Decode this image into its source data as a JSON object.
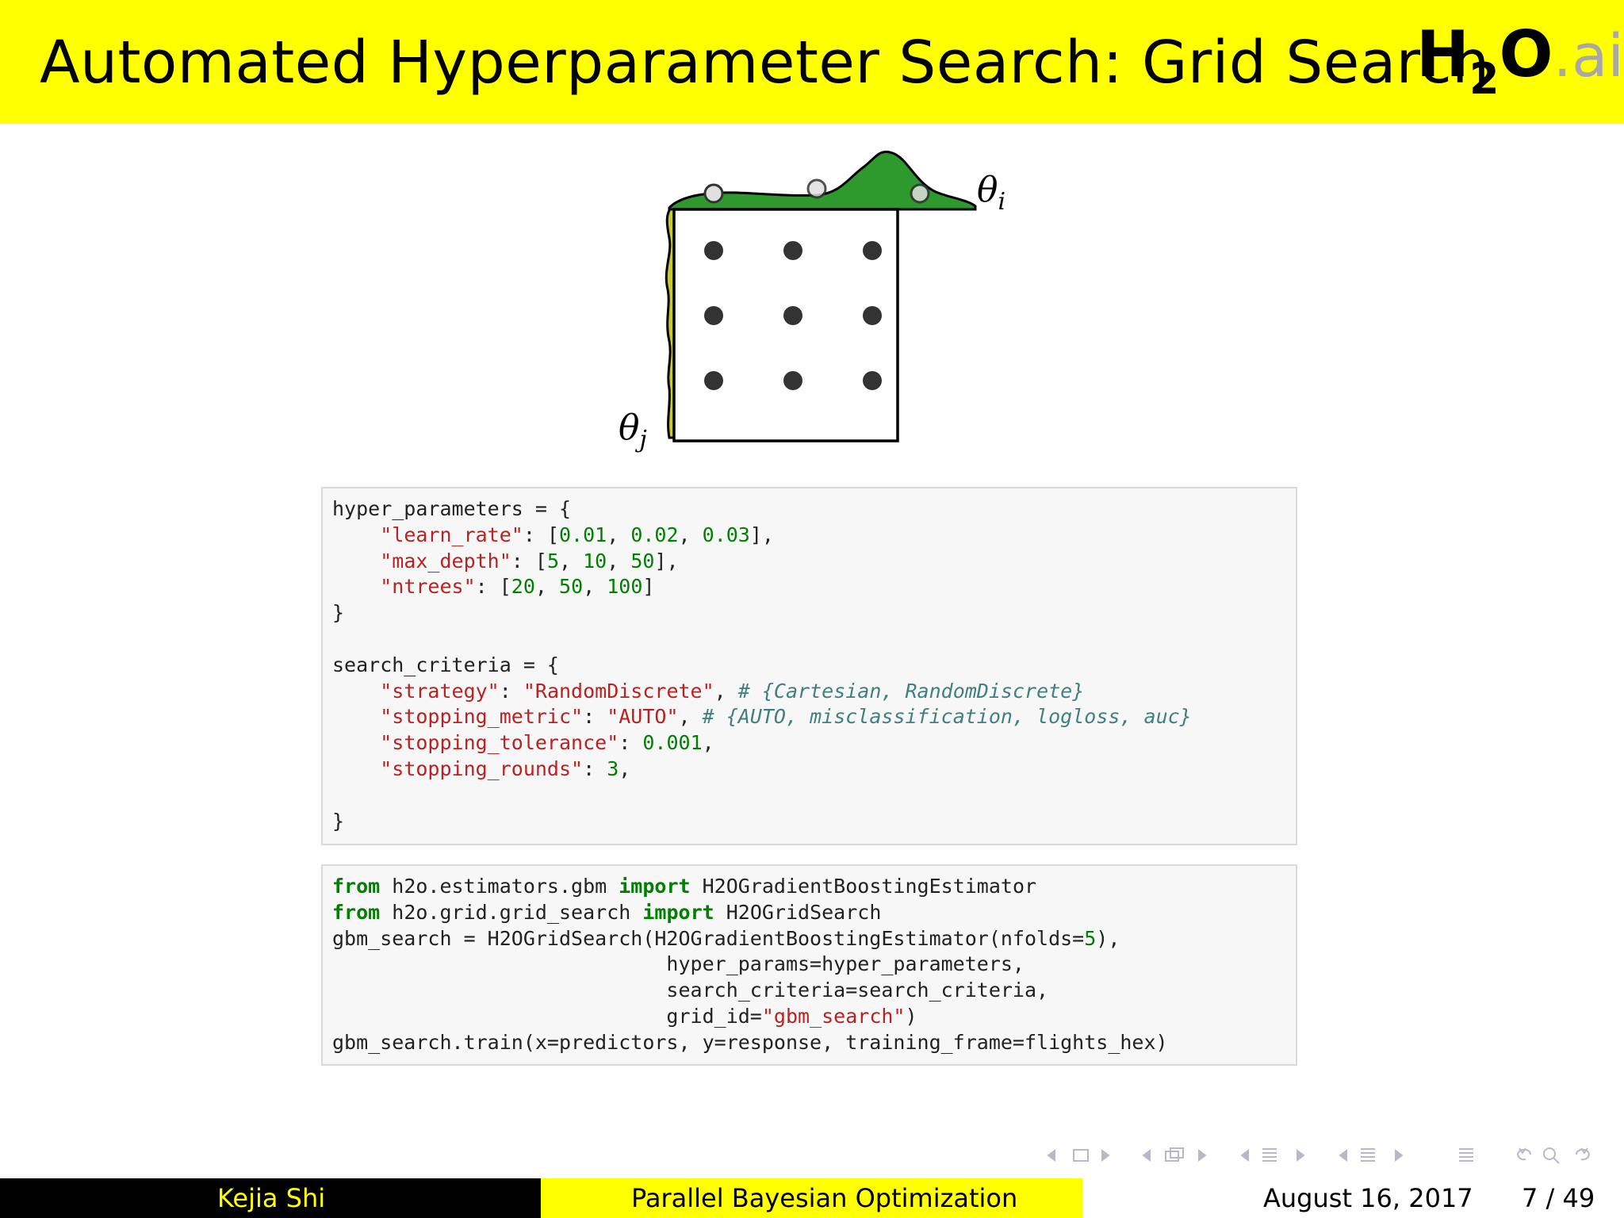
{
  "header": {
    "title": "Automated Hyperparameter Search: Grid Search",
    "logo": {
      "h": "H",
      "two": "2",
      "o": "O",
      "ai": ".ai"
    }
  },
  "diagram": {
    "label_i": "θ",
    "label_i_sub": "i",
    "label_j": "θ",
    "label_j_sub": "j",
    "grid_rows": 3,
    "grid_cols": 3,
    "colors": {
      "top_curve": "#2e9a2e",
      "left_curve": "#c8c830",
      "point": "#333333"
    }
  },
  "code1": {
    "l1": "hyper_parameters = {",
    "l2_key": "\"learn_rate\"",
    "l2_sep": ": [",
    "l2_v1": "0.01",
    "l2_v2": "0.02",
    "l2_v3": "0.03",
    "l2_end": "],",
    "l3_key": "\"max_depth\"",
    "l3_sep": ": [",
    "l3_v1": "5",
    "l3_v2": "10",
    "l3_v3": "50",
    "l3_end": "],",
    "l4_key": "\"ntrees\"",
    "l4_sep": ": [",
    "l4_v1": "20",
    "l4_v2": "50",
    "l4_v3": "100",
    "l4_end": "]",
    "l5": "}",
    "l7": "search_criteria = {",
    "l8_key": "\"strategy\"",
    "l8_sep": ": ",
    "l8_val": "\"RandomDiscrete\"",
    "l8_comma": ", ",
    "l8_comment": "# {Cartesian, RandomDiscrete}",
    "l9_key": "\"stopping_metric\"",
    "l9_sep": ": ",
    "l9_val": "\"AUTO\"",
    "l9_comma": ", ",
    "l9_comment": "# {AUTO, misclassification, logloss, auc}",
    "l10_key": "\"stopping_tolerance\"",
    "l10_sep": ": ",
    "l10_val": "0.001",
    "l10_end": ",",
    "l11_key": "\"stopping_rounds\"",
    "l11_sep": ": ",
    "l11_val": "3",
    "l11_end": ",",
    "l13": "}"
  },
  "code2": {
    "l1_kw1": "from",
    "l1_mod": " h2o.estimators.gbm ",
    "l1_kw2": "import",
    "l1_name": " H2OGradientBoostingEstimator",
    "l2_kw1": "from",
    "l2_mod": " h2o.grid.grid_search ",
    "l2_kw2": "import",
    "l2_name": " H2OGridSearch",
    "l3_a": "gbm_search = H2OGridSearch(H2OGradientBoostingEstimator(nfolds=",
    "l3_num": "5",
    "l3_b": "),",
    "l4": "                            hyper_params=hyper_parameters,",
    "l5": "                            search_criteria=search_criteria,",
    "l6_a": "                            grid_id=",
    "l6_str": "\"gbm_search\"",
    "l6_b": ")",
    "l7": "gbm_search.train(x=predictors, y=response, training_frame=flights_hex)"
  },
  "footer": {
    "author": "Kejia Shi",
    "talk_title": "Parallel Bayesian Optimization",
    "date": "August 16, 2017",
    "page": "7 / 49"
  }
}
